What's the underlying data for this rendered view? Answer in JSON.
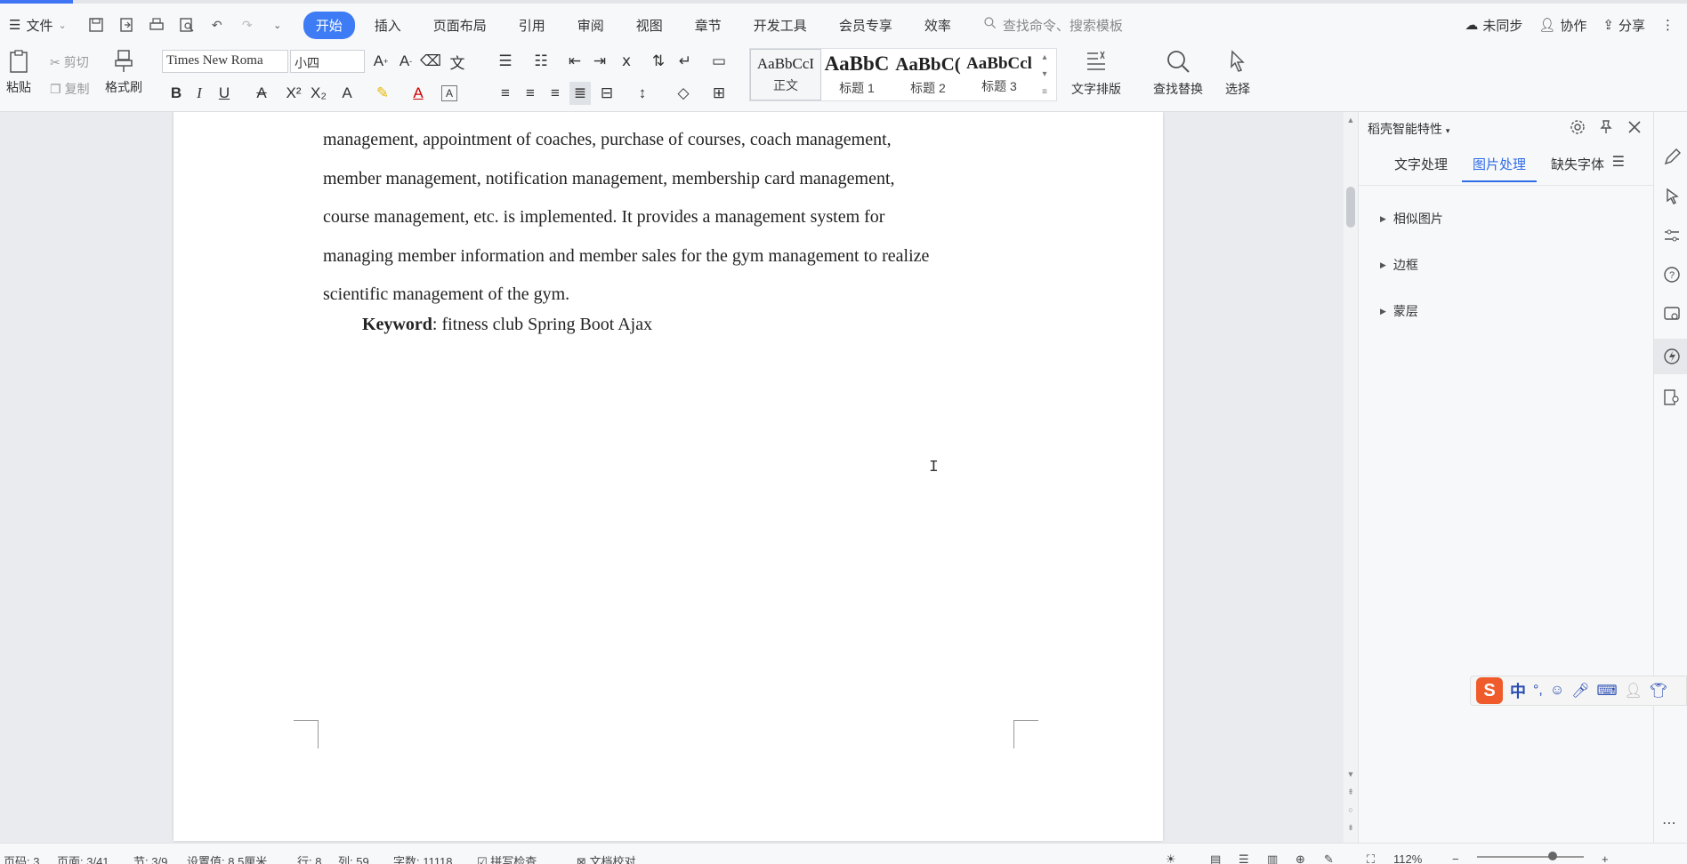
{
  "menu": {
    "file_label": "文件",
    "tabs": [
      "开始",
      "插入",
      "页面布局",
      "引用",
      "审阅",
      "视图",
      "章节",
      "开发工具",
      "会员专享",
      "效率"
    ],
    "active_tab": "开始",
    "search_placeholder": "查找命令、搜索模板",
    "right": {
      "sync": "未同步",
      "collab": "协作",
      "share": "分享"
    }
  },
  "ribbon": {
    "paste": "粘贴",
    "cut": "剪切",
    "copy": "复制",
    "format_painter": "格式刷",
    "font_name": "Times New Roma",
    "font_size": "小四",
    "styles": [
      {
        "sample": "AaBbCcI",
        "label": "正文"
      },
      {
        "sample": "AaBbC",
        "label": "标题 1"
      },
      {
        "sample": "AaBbC(",
        "label": "标题 2"
      },
      {
        "sample": "AaBbCcl",
        "label": "标题 3"
      }
    ],
    "text_layout": "文字排版",
    "find_replace": "查找替换",
    "select": "选择"
  },
  "document": {
    "lines": [
      "management, appointment of coaches, purchase of courses, coach management,",
      "member management, notification management, membership card management,",
      "course management, etc. is implemented. It provides a management system for",
      "managing member information and member sales for the gym management to realize",
      "scientific management of the gym."
    ],
    "keyword_label": "Keyword",
    "keyword_text": ": fitness club Spring Boot Ajax"
  },
  "panel": {
    "title": "稻壳智能特性",
    "tabs": [
      "文字处理",
      "图片处理",
      "缺失字体"
    ],
    "active_tab": "图片处理",
    "items": [
      "相似图片",
      "边框",
      "蒙层"
    ]
  },
  "ime": {
    "char": "中"
  },
  "status": {
    "page_num": "页码: 3",
    "page": "页面: 3/41",
    "section": "节: 3/9",
    "setting": "设置值: 8.5厘米",
    "row": "行: 8",
    "col": "列: 59",
    "words": "字数: 11118",
    "spell": "拼写检查",
    "proof": "文档校对",
    "zoom": "112%"
  }
}
